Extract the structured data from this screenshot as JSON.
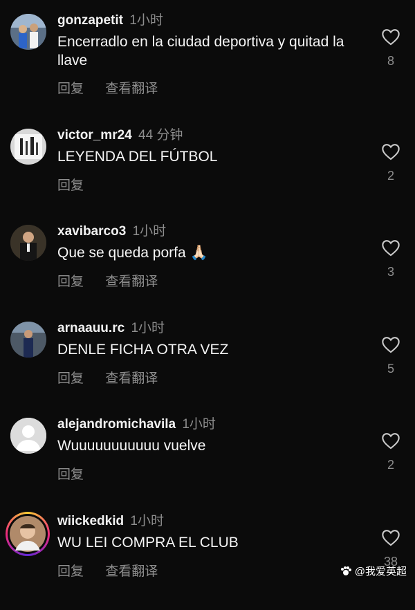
{
  "comments": [
    {
      "username": "gonzapetit",
      "time": "1小时",
      "text": "Encerradlo en la ciudad deportiva y quitad la llave",
      "reply": "回复",
      "translate": "查看翻译",
      "likes": "8"
    },
    {
      "username": "victor_mr24",
      "time": "44 分钟",
      "text": "LEYENDA DEL FÚTBOL",
      "reply": "回复",
      "translate": "",
      "likes": "2"
    },
    {
      "username": "xavibarco3",
      "time": "1小时",
      "text": "Que se queda porfa 🙏🏻",
      "reply": "回复",
      "translate": "查看翻译",
      "likes": "3"
    },
    {
      "username": "arnaauu.rc",
      "time": "1小时",
      "text": "DENLE FICHA OTRA VEZ",
      "reply": "回复",
      "translate": "查看翻译",
      "likes": "5"
    },
    {
      "username": "alejandromichavila",
      "time": "1小时",
      "text": "Wuuuuuuuuuuu vuelve",
      "reply": "回复",
      "translate": "",
      "likes": "2"
    },
    {
      "username": "wiickedkid",
      "time": "1小时",
      "text": "WU LEI COMPRA EL CLUB",
      "reply": "回复",
      "translate": "查看翻译",
      "likes": "38"
    }
  ],
  "watermark": "@我爱英超",
  "colors": {
    "background": "#0b0b0b",
    "muted": "#8e8e8e",
    "story_ring": "#e1306c"
  }
}
